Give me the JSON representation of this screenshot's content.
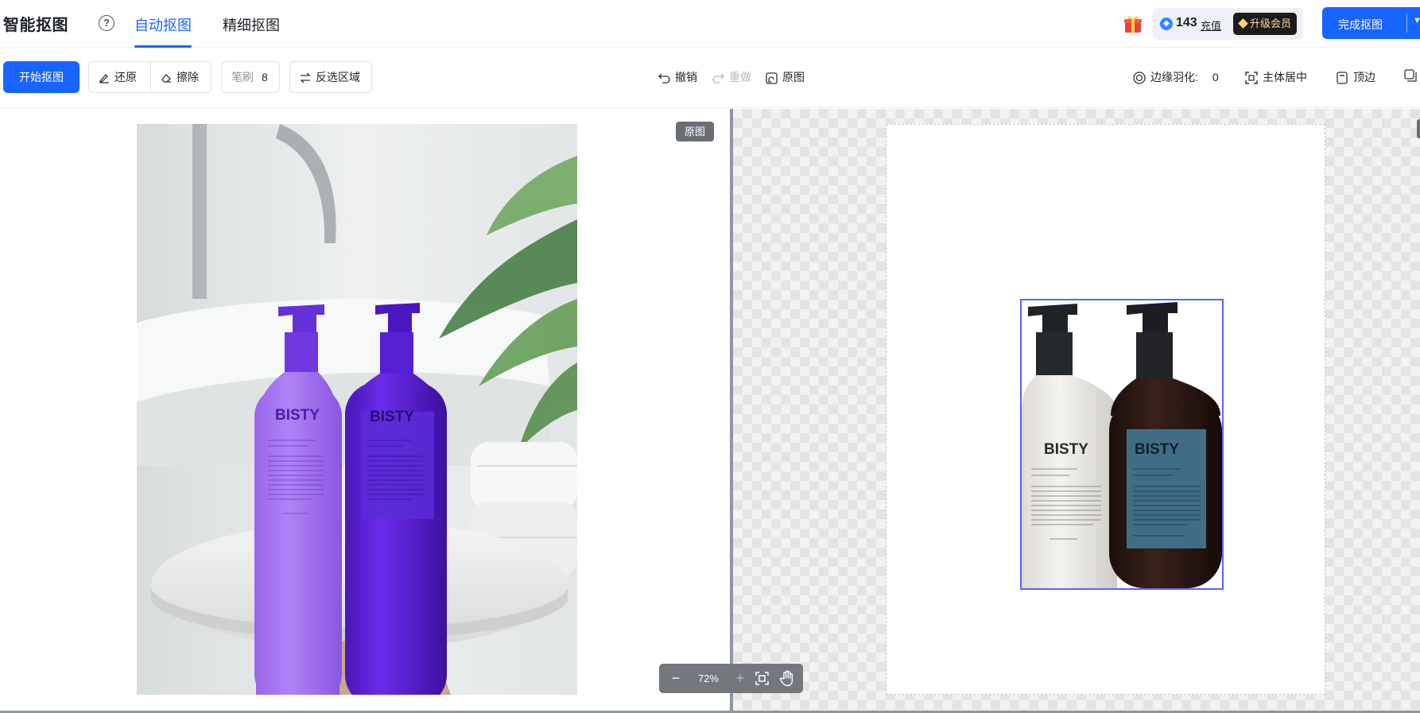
{
  "header": {
    "app_title": "智能抠图",
    "tabs": [
      {
        "label": "自动抠图",
        "active": true
      },
      {
        "label": "精细抠图",
        "active": false
      }
    ],
    "credits": "143",
    "recharge_label": "充值",
    "vip_label": "升级会员",
    "finish_label": "完成抠图"
  },
  "toolbar": {
    "start_label": "开始抠图",
    "restore_label": "还原",
    "erase_label": "擦除",
    "brush_label": "笔刷",
    "brush_size": "8",
    "invert_label": "反选区域",
    "undo_label": "撤销",
    "redo_label": "重做",
    "original_label": "原图",
    "feather_label": "边缘羽化:",
    "feather_value": "0",
    "center_label": "主体居中",
    "top_edge_label": "顶边"
  },
  "workspace": {
    "original_badge": "原图",
    "zoom_level": "72%",
    "bottle_brand": "BISTY"
  },
  "colors": {
    "accent": "#1764ff",
    "selection": "#5b63ff",
    "bottle_light_purple": "#a674f2",
    "bottle_dark_purple": "#5a1fcf",
    "bottle_white": "#eceae6",
    "bottle_amber": "#2a1a14",
    "label_teal": "#3f6d86"
  },
  "icons": {
    "help": "question-circle-icon",
    "gift": "gift-icon",
    "coin": "coin-icon",
    "vip": "diamond-icon",
    "restore": "brush-restore-icon",
    "erase": "eraser-icon",
    "invert": "swap-arrows-icon",
    "undo": "undo-icon",
    "redo": "redo-icon",
    "original": "compare-icon",
    "feather": "target-circle-icon",
    "center": "focus-frame-icon",
    "top_edge": "top-align-icon",
    "zoom_out": "minus-icon",
    "zoom_in": "plus-icon",
    "fit": "fit-screen-icon",
    "pan": "hand-icon"
  }
}
